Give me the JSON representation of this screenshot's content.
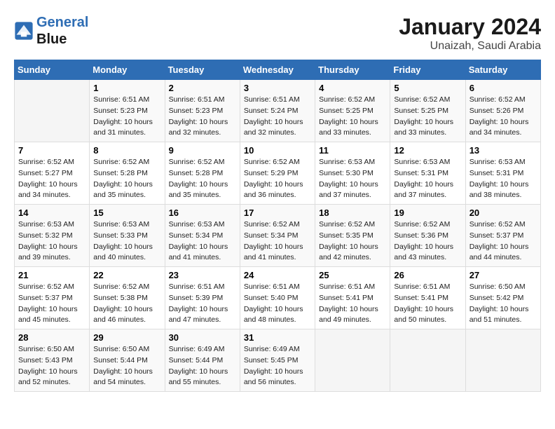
{
  "logo": {
    "line1": "General",
    "line2": "Blue"
  },
  "title": "January 2024",
  "subtitle": "Unaizah, Saudi Arabia",
  "days_header": [
    "Sunday",
    "Monday",
    "Tuesday",
    "Wednesday",
    "Thursday",
    "Friday",
    "Saturday"
  ],
  "weeks": [
    [
      {
        "day": "",
        "sunrise": "",
        "sunset": "",
        "daylight": ""
      },
      {
        "day": "1",
        "sunrise": "Sunrise: 6:51 AM",
        "sunset": "Sunset: 5:23 PM",
        "daylight": "Daylight: 10 hours and 31 minutes."
      },
      {
        "day": "2",
        "sunrise": "Sunrise: 6:51 AM",
        "sunset": "Sunset: 5:23 PM",
        "daylight": "Daylight: 10 hours and 32 minutes."
      },
      {
        "day": "3",
        "sunrise": "Sunrise: 6:51 AM",
        "sunset": "Sunset: 5:24 PM",
        "daylight": "Daylight: 10 hours and 32 minutes."
      },
      {
        "day": "4",
        "sunrise": "Sunrise: 6:52 AM",
        "sunset": "Sunset: 5:25 PM",
        "daylight": "Daylight: 10 hours and 33 minutes."
      },
      {
        "day": "5",
        "sunrise": "Sunrise: 6:52 AM",
        "sunset": "Sunset: 5:25 PM",
        "daylight": "Daylight: 10 hours and 33 minutes."
      },
      {
        "day": "6",
        "sunrise": "Sunrise: 6:52 AM",
        "sunset": "Sunset: 5:26 PM",
        "daylight": "Daylight: 10 hours and 34 minutes."
      }
    ],
    [
      {
        "day": "7",
        "sunrise": "Sunrise: 6:52 AM",
        "sunset": "Sunset: 5:27 PM",
        "daylight": "Daylight: 10 hours and 34 minutes."
      },
      {
        "day": "8",
        "sunrise": "Sunrise: 6:52 AM",
        "sunset": "Sunset: 5:28 PM",
        "daylight": "Daylight: 10 hours and 35 minutes."
      },
      {
        "day": "9",
        "sunrise": "Sunrise: 6:52 AM",
        "sunset": "Sunset: 5:28 PM",
        "daylight": "Daylight: 10 hours and 35 minutes."
      },
      {
        "day": "10",
        "sunrise": "Sunrise: 6:52 AM",
        "sunset": "Sunset: 5:29 PM",
        "daylight": "Daylight: 10 hours and 36 minutes."
      },
      {
        "day": "11",
        "sunrise": "Sunrise: 6:53 AM",
        "sunset": "Sunset: 5:30 PM",
        "daylight": "Daylight: 10 hours and 37 minutes."
      },
      {
        "day": "12",
        "sunrise": "Sunrise: 6:53 AM",
        "sunset": "Sunset: 5:31 PM",
        "daylight": "Daylight: 10 hours and 37 minutes."
      },
      {
        "day": "13",
        "sunrise": "Sunrise: 6:53 AM",
        "sunset": "Sunset: 5:31 PM",
        "daylight": "Daylight: 10 hours and 38 minutes."
      }
    ],
    [
      {
        "day": "14",
        "sunrise": "Sunrise: 6:53 AM",
        "sunset": "Sunset: 5:32 PM",
        "daylight": "Daylight: 10 hours and 39 minutes."
      },
      {
        "day": "15",
        "sunrise": "Sunrise: 6:53 AM",
        "sunset": "Sunset: 5:33 PM",
        "daylight": "Daylight: 10 hours and 40 minutes."
      },
      {
        "day": "16",
        "sunrise": "Sunrise: 6:53 AM",
        "sunset": "Sunset: 5:34 PM",
        "daylight": "Daylight: 10 hours and 41 minutes."
      },
      {
        "day": "17",
        "sunrise": "Sunrise: 6:52 AM",
        "sunset": "Sunset: 5:34 PM",
        "daylight": "Daylight: 10 hours and 41 minutes."
      },
      {
        "day": "18",
        "sunrise": "Sunrise: 6:52 AM",
        "sunset": "Sunset: 5:35 PM",
        "daylight": "Daylight: 10 hours and 42 minutes."
      },
      {
        "day": "19",
        "sunrise": "Sunrise: 6:52 AM",
        "sunset": "Sunset: 5:36 PM",
        "daylight": "Daylight: 10 hours and 43 minutes."
      },
      {
        "day": "20",
        "sunrise": "Sunrise: 6:52 AM",
        "sunset": "Sunset: 5:37 PM",
        "daylight": "Daylight: 10 hours and 44 minutes."
      }
    ],
    [
      {
        "day": "21",
        "sunrise": "Sunrise: 6:52 AM",
        "sunset": "Sunset: 5:37 PM",
        "daylight": "Daylight: 10 hours and 45 minutes."
      },
      {
        "day": "22",
        "sunrise": "Sunrise: 6:52 AM",
        "sunset": "Sunset: 5:38 PM",
        "daylight": "Daylight: 10 hours and 46 minutes."
      },
      {
        "day": "23",
        "sunrise": "Sunrise: 6:51 AM",
        "sunset": "Sunset: 5:39 PM",
        "daylight": "Daylight: 10 hours and 47 minutes."
      },
      {
        "day": "24",
        "sunrise": "Sunrise: 6:51 AM",
        "sunset": "Sunset: 5:40 PM",
        "daylight": "Daylight: 10 hours and 48 minutes."
      },
      {
        "day": "25",
        "sunrise": "Sunrise: 6:51 AM",
        "sunset": "Sunset: 5:41 PM",
        "daylight": "Daylight: 10 hours and 49 minutes."
      },
      {
        "day": "26",
        "sunrise": "Sunrise: 6:51 AM",
        "sunset": "Sunset: 5:41 PM",
        "daylight": "Daylight: 10 hours and 50 minutes."
      },
      {
        "day": "27",
        "sunrise": "Sunrise: 6:50 AM",
        "sunset": "Sunset: 5:42 PM",
        "daylight": "Daylight: 10 hours and 51 minutes."
      }
    ],
    [
      {
        "day": "28",
        "sunrise": "Sunrise: 6:50 AM",
        "sunset": "Sunset: 5:43 PM",
        "daylight": "Daylight: 10 hours and 52 minutes."
      },
      {
        "day": "29",
        "sunrise": "Sunrise: 6:50 AM",
        "sunset": "Sunset: 5:44 PM",
        "daylight": "Daylight: 10 hours and 54 minutes."
      },
      {
        "day": "30",
        "sunrise": "Sunrise: 6:49 AM",
        "sunset": "Sunset: 5:44 PM",
        "daylight": "Daylight: 10 hours and 55 minutes."
      },
      {
        "day": "31",
        "sunrise": "Sunrise: 6:49 AM",
        "sunset": "Sunset: 5:45 PM",
        "daylight": "Daylight: 10 hours and 56 minutes."
      },
      {
        "day": "",
        "sunrise": "",
        "sunset": "",
        "daylight": ""
      },
      {
        "day": "",
        "sunrise": "",
        "sunset": "",
        "daylight": ""
      },
      {
        "day": "",
        "sunrise": "",
        "sunset": "",
        "daylight": ""
      }
    ]
  ]
}
